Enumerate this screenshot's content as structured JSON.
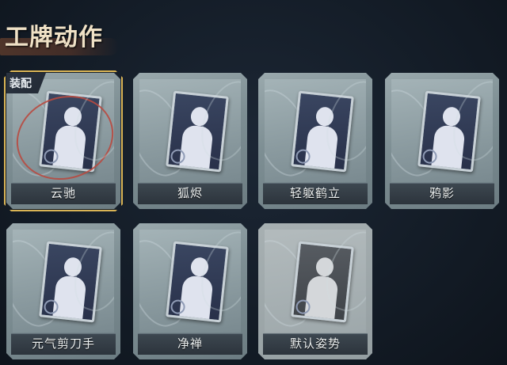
{
  "header": {
    "title": "工牌动作"
  },
  "equipped_tag": "装配",
  "cards": [
    {
      "label": "云驰",
      "equipped": true,
      "style": "normal"
    },
    {
      "label": "狐烬",
      "equipped": false,
      "style": "normal"
    },
    {
      "label": "轻躯鹤立",
      "equipped": false,
      "style": "normal"
    },
    {
      "label": "鸦影",
      "equipped": false,
      "style": "normal"
    },
    {
      "label": "元气剪刀手",
      "equipped": false,
      "style": "normal"
    },
    {
      "label": "净禅",
      "equipped": false,
      "style": "normal"
    },
    {
      "label": "默认姿势",
      "equipped": false,
      "style": "default"
    }
  ],
  "colors": {
    "background": "#141d28",
    "card_frame": "#7d8e93",
    "selected_border": "#d9b455",
    "label_bar": "#2c343c",
    "title_text": "#efe1c6",
    "title_brush": "#5a3a2c"
  }
}
